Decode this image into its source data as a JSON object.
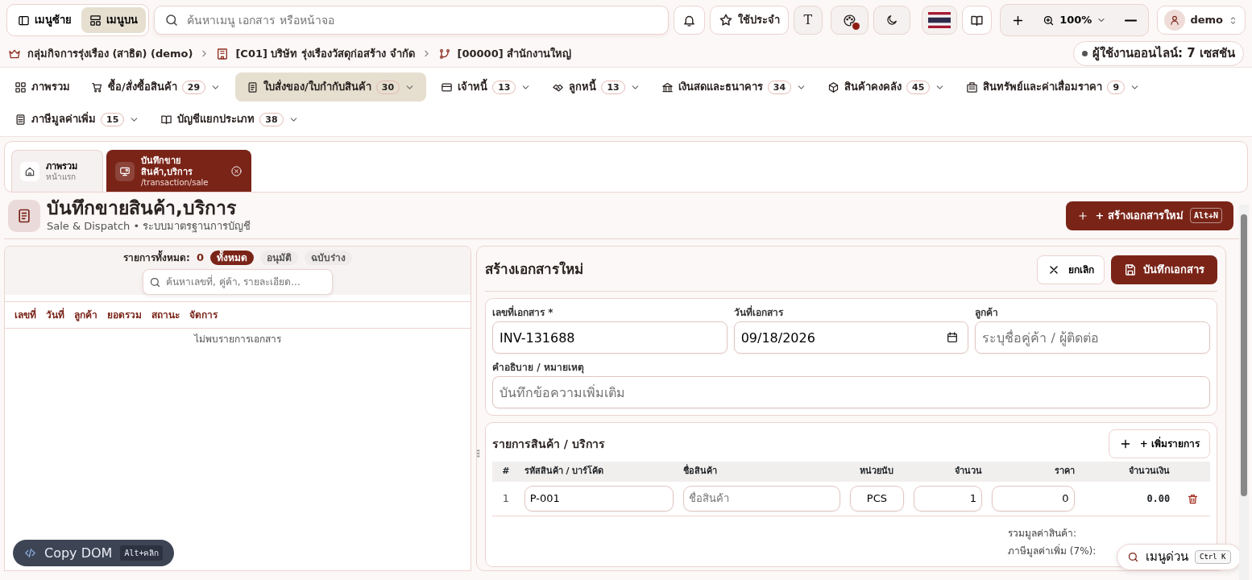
{
  "top_bar": {
    "menu_modes": [
      {
        "label": "เมนูซ้าย",
        "selected": false
      },
      {
        "label": "เมนูบน",
        "selected": true
      }
    ],
    "search": {
      "placeholder": "ค้นหาเมนู เอกสาร หรือหน้าจอ"
    },
    "favorites_label": "ใช้ประจำ",
    "font_label": "T",
    "zoom": "100%",
    "user": "demo"
  },
  "breadcrumb": [
    {
      "label": "กลุ่มกิจการรุ่งเรือง (สาธิต) (demo)",
      "kind": "group"
    },
    {
      "label": "[C01] บริษัท รุ่งเรืองวัสดุก่อสร้าง จำกัด",
      "kind": "company"
    },
    {
      "label": "[00000] สำนักงานใหญ่",
      "kind": "branch"
    }
  ],
  "online_status": "ผู้ใช้งานออนไลน์: 7 เซสชัน",
  "main_menu": [
    {
      "label": "ภาพรวม",
      "selected": false
    },
    {
      "label": "ซื้อ/สั่งซื้อสินค้า",
      "count": "29",
      "selected": false
    },
    {
      "label": "ใบสั่งของ/ใบกำกับสินค้า",
      "count": "30",
      "selected": true
    },
    {
      "label": "เจ้าหนี้",
      "count": "13",
      "selected": false
    },
    {
      "label": "ลูกหนี้",
      "count": "13",
      "selected": false
    },
    {
      "label": "เงินสดและธนาคาร",
      "count": "34",
      "selected": false
    },
    {
      "label": "สินค้าคงคลัง",
      "count": "45",
      "selected": false
    },
    {
      "label": "สินทรัพย์และค่าเสื่อมราคา",
      "count": "9",
      "selected": false
    },
    {
      "label": "ภาษีมูลค่าเพิ่ม",
      "count": "15",
      "selected": false
    },
    {
      "label": "บัญชีแยกประเภท",
      "count": "38",
      "selected": false
    }
  ],
  "open_tabs": [
    {
      "title": "ภาพรวม",
      "subtitle": "หน้าแรก",
      "selected": false,
      "closable": false
    },
    {
      "title": "บันทึกขายสินค้า,บริการ",
      "subtitle": "/transaction/sale",
      "selected": true,
      "closable": true
    }
  ],
  "page": {
    "title": "บันทึกขายสินค้า,บริการ",
    "subtitle": "Sale & Dispatch • ระบบมาตรฐานการบัญชี",
    "create_button": "+ สร้างเอกสารใหม่",
    "create_shortcut": "Alt+N"
  },
  "document_list": {
    "total_label": "รายการทั้งหมด:",
    "total": "0",
    "filters": [
      {
        "label": "ทั้งหมด",
        "selected": true
      },
      {
        "label": "อนุมัติ",
        "selected": false
      },
      {
        "label": "ฉบับร่าง",
        "selected": false
      }
    ],
    "search": {
      "placeholder": "ค้นหาเลขที่, คู่ค้า, รายละเอียด..."
    },
    "columns": [
      "เลขที่",
      "วันที่",
      "ลูกค้า",
      "ยอดรวม",
      "สถานะ",
      "จัดการ"
    ],
    "empty_message": "ไม่พบรายการเอกสาร"
  },
  "form": {
    "title": "สร้างเอกสารใหม่",
    "cancel_button": "ยกเลิก",
    "save_button": "บันทึกเอกสาร",
    "fields": [
      {
        "label": "เลขที่เอกสาร *",
        "value": "INV-131688",
        "kind": "text"
      },
      {
        "label": "วันที่เอกสาร",
        "value": "09/18/2026",
        "kind": "date"
      },
      {
        "label": "ลูกค้า",
        "placeholder": "ระบุชื่อคู่ค้า / ผู้ติดต่อ",
        "kind": "text"
      }
    ],
    "note": {
      "label": "คำอธิบาย / หมายเหตุ",
      "placeholder": "บันทึกข้อความเพิ่มเติม"
    }
  },
  "items": {
    "title": "รายการสินค้า / บริการ",
    "add_button": "+ เพิ่มรายการ",
    "columns": [
      "#",
      "รหัสสินค้า / บาร์โค้ด",
      "ชื่อสินค้า",
      "หน่วยนับ",
      "จำนวน",
      "ราคา",
      "จำนวนเงิน"
    ],
    "rows": [
      {
        "no": "1",
        "code": "P-001",
        "name_placeholder": "ชื่อสินค้า",
        "unit": "PCS",
        "quantity": "1",
        "price": "0",
        "amount": "0.00"
      }
    ],
    "summary": [
      "รวมมูลค่าสินค้า:",
      "ภาษีมูลค่าเพิ่ม (7%):"
    ]
  },
  "copy_dom": {
    "label": "Copy DOM",
    "shortcut": "Alt+คลิก"
  },
  "quick_menu": {
    "label": "เมนูด่วน",
    "shortcut": "Ctrl K"
  }
}
